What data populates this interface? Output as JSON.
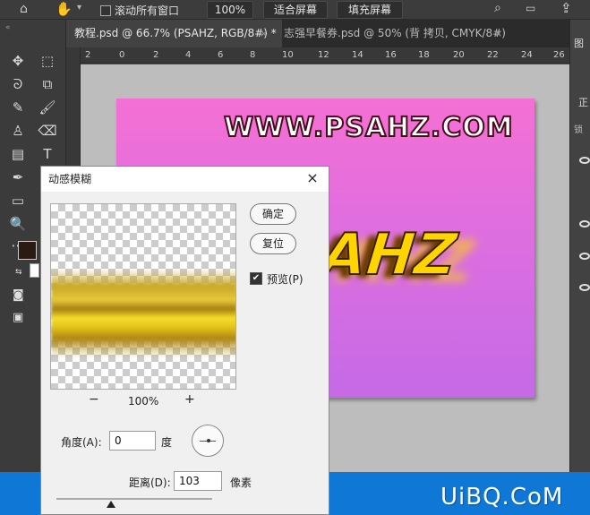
{
  "options_bar": {
    "scroll_all_windows": "滚动所有窗口",
    "zoom_btn": "100%",
    "fit_screen": "适合屏幕",
    "fill_screen": "填充屏幕"
  },
  "tabs": [
    {
      "label": "教程.psd @ 66.7% (PSAHZ, RGB/8#) *",
      "close": "×"
    },
    {
      "label": "志强早餐券.psd @ 50% (背 拷贝, CMYK/8#)",
      "close": "×"
    }
  ],
  "ruler": [
    "2",
    "0",
    "2",
    "4",
    "6",
    "8",
    "10",
    "12",
    "14",
    "16",
    "18",
    "20",
    "22",
    "24",
    "26"
  ],
  "canvas": {
    "site_text": "WWW.PSAHZ.COM",
    "ahz_text": "AHZ"
  },
  "right_panel": {
    "title": "图",
    "tab2": "正",
    "tab3": "锁"
  },
  "dialog": {
    "title": "动感模糊",
    "close": "×",
    "ok": "确定",
    "reset": "复位",
    "preview_label": "预览(P)",
    "preview_checked": "✔",
    "zoom_out": "−",
    "zoom_level": "100%",
    "zoom_in": "+",
    "angle_label": "角度(A):",
    "angle_value": "0",
    "angle_unit": "度",
    "distance_label": "距离(D):",
    "distance_value": "103",
    "distance_unit": "像素"
  },
  "watermark": "UiBQ.CoM"
}
